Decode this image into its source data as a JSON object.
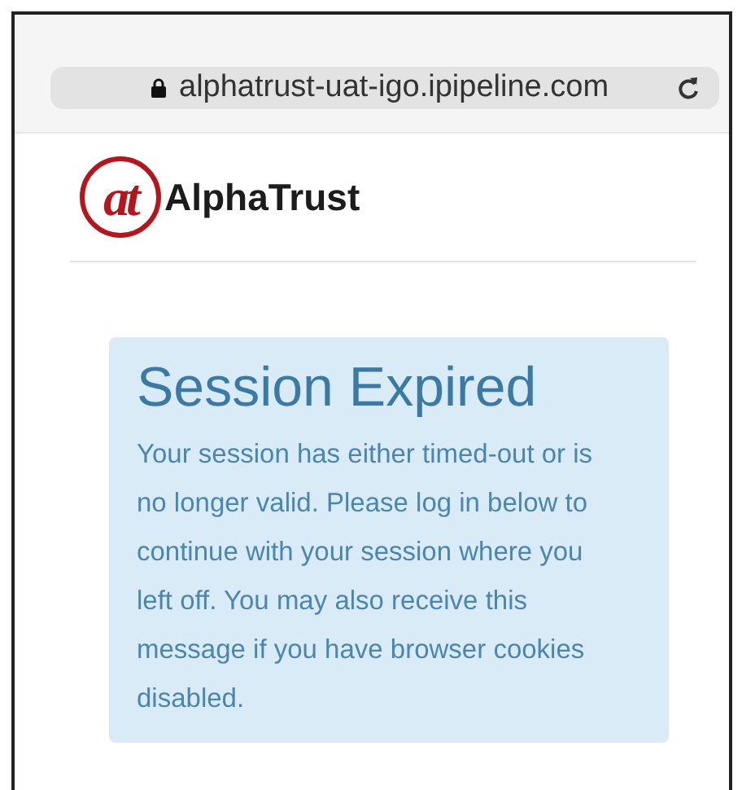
{
  "address_bar": {
    "url": "alphatrust-uat-igo.ipipeline.com"
  },
  "logo": {
    "mark": "at",
    "name": "AlphaTrust"
  },
  "alert": {
    "title": "Session Expired",
    "message": "Your session has either timed-out or is no longer valid. Please log in below to continue with your session where you left off. You may also receive this message if you have browser cookies disabled."
  }
}
